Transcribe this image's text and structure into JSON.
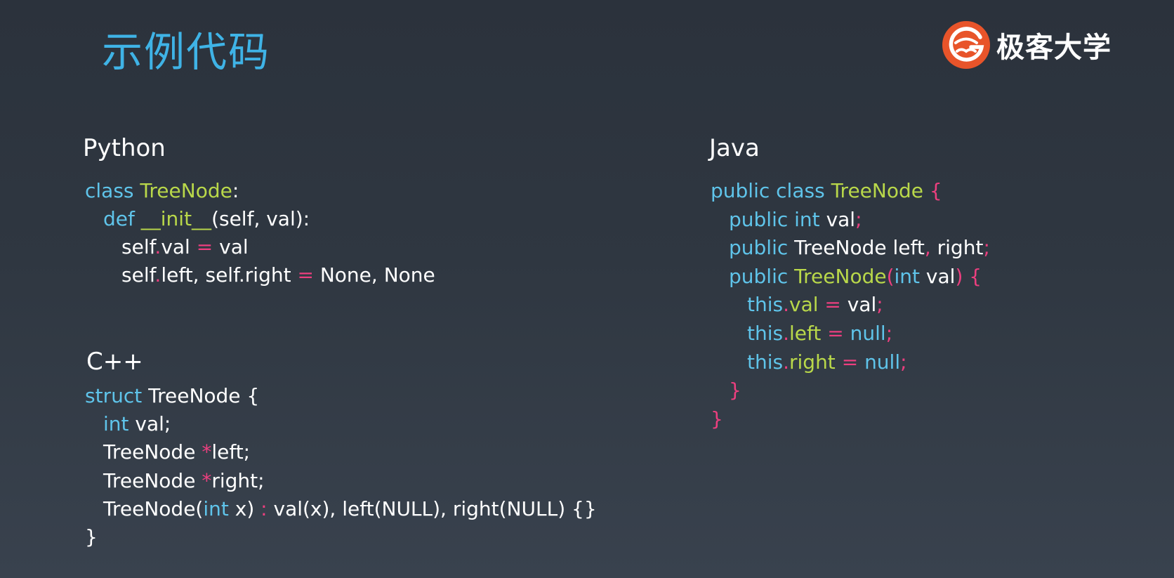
{
  "title": "示例代码",
  "brand": {
    "logo_icon": "geekbang-logo-icon",
    "name": "极客大学"
  },
  "colors": {
    "title": "#3fb3e6",
    "keyword": "#5fc4ea",
    "class_name": "#b9d84a",
    "operator": "#ec3f7f",
    "text": "#ffffff",
    "logo": "#e8542a"
  },
  "sections": {
    "python": {
      "label": "Python",
      "lines": [
        [
          {
            "t": "class ",
            "c": "kw"
          },
          {
            "t": "TreeNode",
            "c": "cls"
          },
          {
            "t": ":",
            "c": ""
          }
        ],
        [
          {
            "t": "def ",
            "c": "kw"
          },
          {
            "t": "__init__",
            "c": "cls"
          },
          {
            "t": "(self, val):",
            "c": ""
          }
        ],
        [
          {
            "t": "self",
            "c": ""
          },
          {
            "t": ".",
            "c": "op"
          },
          {
            "t": "val ",
            "c": ""
          },
          {
            "t": "=",
            "c": "op"
          },
          {
            "t": " val",
            "c": ""
          }
        ],
        [
          {
            "t": "self",
            "c": ""
          },
          {
            "t": ".",
            "c": "op"
          },
          {
            "t": "left, self.right ",
            "c": ""
          },
          {
            "t": "=",
            "c": "op"
          },
          {
            "t": " None, None",
            "c": ""
          }
        ]
      ]
    },
    "cpp": {
      "label": "C++",
      "lines": [
        [
          {
            "t": "struct ",
            "c": "kw"
          },
          {
            "t": "TreeNode {",
            "c": ""
          }
        ],
        [
          {
            "t": "int ",
            "c": "kw"
          },
          {
            "t": "val;",
            "c": ""
          }
        ],
        [
          {
            "t": "TreeNode ",
            "c": ""
          },
          {
            "t": "*",
            "c": "op"
          },
          {
            "t": "left;",
            "c": ""
          }
        ],
        [
          {
            "t": "TreeNode ",
            "c": ""
          },
          {
            "t": "*",
            "c": "op"
          },
          {
            "t": "right;",
            "c": ""
          }
        ],
        [
          {
            "t": "TreeNode(",
            "c": ""
          },
          {
            "t": "int",
            "c": "kw"
          },
          {
            "t": " x) ",
            "c": ""
          },
          {
            "t": ":",
            "c": "op"
          },
          {
            "t": " val(x), left(NULL), right(NULL) {}",
            "c": ""
          }
        ],
        [
          {
            "t": "}",
            "c": ""
          }
        ]
      ]
    },
    "java": {
      "label": "Java",
      "lines": [
        [
          {
            "t": "public class ",
            "c": "kw"
          },
          {
            "t": "TreeNode",
            "c": "cls"
          },
          {
            "t": " {",
            "c": "op"
          }
        ],
        [
          {
            "t": "public int ",
            "c": "kw"
          },
          {
            "t": "val",
            "c": ""
          },
          {
            "t": ";",
            "c": "op"
          }
        ],
        [
          {
            "t": "public ",
            "c": "kw"
          },
          {
            "t": "TreeNode left",
            "c": ""
          },
          {
            "t": ",",
            "c": "op"
          },
          {
            "t": " right",
            "c": ""
          },
          {
            "t": ";",
            "c": "op"
          }
        ],
        [
          {
            "t": "public ",
            "c": "kw"
          },
          {
            "t": "TreeNode",
            "c": "cls"
          },
          {
            "t": "(",
            "c": "op"
          },
          {
            "t": "int",
            "c": "kw"
          },
          {
            "t": " val",
            "c": ""
          },
          {
            "t": ") {",
            "c": "op"
          }
        ],
        [
          {
            "t": "this",
            "c": "kw"
          },
          {
            "t": ".",
            "c": "op"
          },
          {
            "t": "val",
            "c": "cls"
          },
          {
            "t": " = ",
            "c": "op"
          },
          {
            "t": "val",
            "c": ""
          },
          {
            "t": ";",
            "c": "op"
          }
        ],
        [
          {
            "t": "this",
            "c": "kw"
          },
          {
            "t": ".",
            "c": "op"
          },
          {
            "t": "left",
            "c": "cls"
          },
          {
            "t": " = ",
            "c": "op"
          },
          {
            "t": "null",
            "c": "kw"
          },
          {
            "t": ";",
            "c": "op"
          }
        ],
        [
          {
            "t": "this",
            "c": "kw"
          },
          {
            "t": ".",
            "c": "op"
          },
          {
            "t": "right",
            "c": "cls"
          },
          {
            "t": " = ",
            "c": "op"
          },
          {
            "t": "null",
            "c": "kw"
          },
          {
            "t": ";",
            "c": "op"
          }
        ],
        [
          {
            "t": "}",
            "c": "op"
          }
        ],
        [
          {
            "t": "}",
            "c": "op"
          }
        ]
      ]
    }
  }
}
